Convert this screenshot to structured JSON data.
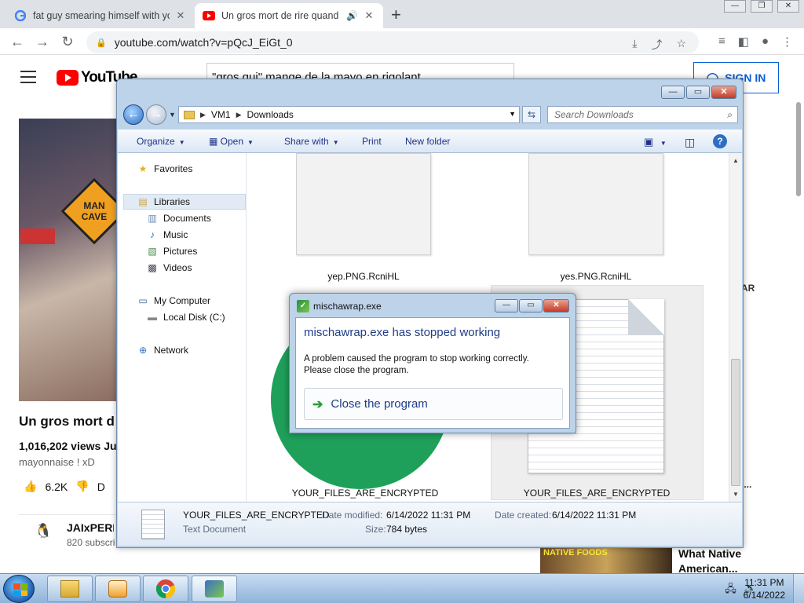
{
  "browser": {
    "tabs": [
      {
        "title": "fat guy smearing himself with yo",
        "active": false
      },
      {
        "title": "Un gros mort de rire quand",
        "active": true
      }
    ],
    "url": "youtube.com/watch?v=pQcJ_EiGt_0"
  },
  "youtube": {
    "logo_text": "YouTube",
    "search_value": "\"gros gui\" mange de la mayo en rigolant",
    "signin_label": "SIGN IN",
    "video_title": "Un gros mort d",
    "views": "1,016,202 views  Ju",
    "description": "mayonnaise ! xD",
    "likes": "6.2K",
    "dislike_label": "D",
    "channel_name": "JAIxPERD",
    "channel_subs": "820 subscri",
    "mancave_text": "MAN CAVE",
    "side_peek": [
      "AR",
      "i..."
    ],
    "rec_thumb_text": "NATIVE FOODS",
    "rec_title_1": "What Native",
    "rec_title_2": "American..."
  },
  "explorer": {
    "path": [
      "VM1",
      "Downloads"
    ],
    "search_placeholder": "Search Downloads",
    "commands": [
      "Organize",
      "Open",
      "Share with",
      "Print",
      "New folder"
    ],
    "nav": {
      "favorites": "Favorites",
      "libraries": "Libraries",
      "documents": "Documents",
      "music": "Music",
      "pictures": "Pictures",
      "videos": "Videos",
      "computer": "My Computer",
      "local_disk": "Local Disk (C:)",
      "network": "Network"
    },
    "files": [
      "yep.PNG.RcniHL",
      "yes.PNG.RcniHL",
      "YOUR_FILES_ARE_ENCRYPTED",
      "YOUR_FILES_ARE_ENCRYPTED"
    ],
    "details": {
      "name": "YOUR_FILES_ARE_ENCRYPTED",
      "type": "Text Document",
      "modified_label": "Date modified:",
      "modified": "6/14/2022 11:31 PM",
      "created_label": "Date created:",
      "created": "6/14/2022 11:31 PM",
      "size_label": "Size:",
      "size": "784 bytes"
    }
  },
  "dialog": {
    "title": "mischawrap.exe",
    "heading": "mischawrap.exe has stopped working",
    "message_1": "A problem caused the program to stop working correctly.",
    "message_2": "Please close the program.",
    "action": "Close the program"
  },
  "taskbar": {
    "time": "11:31 PM",
    "date": "6/14/2022"
  },
  "icons": [
    "search-icon",
    "back-icon",
    "forward-icon",
    "refresh-icon",
    "close-icon",
    "folder-icon",
    "star-icon",
    "speaker-icon",
    "network-icon"
  ]
}
